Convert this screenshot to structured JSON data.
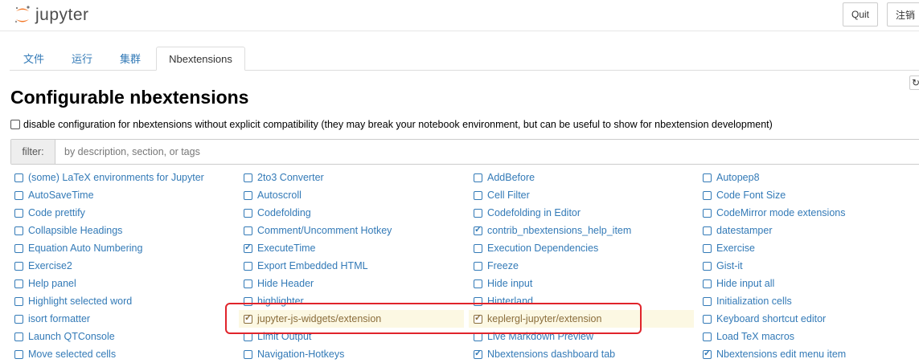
{
  "header": {
    "logo_text": "jupyter",
    "quit_label": "Quit",
    "logout_label": "注销"
  },
  "tabs": [
    {
      "label": "文件",
      "active": false
    },
    {
      "label": "运行",
      "active": false
    },
    {
      "label": "集群",
      "active": false
    },
    {
      "label": "Nbextensions",
      "active": true
    }
  ],
  "refresh_icon": "refresh-icon",
  "page": {
    "title": "Configurable nbextensions",
    "compat_label": "disable configuration for nbextensions without explicit compatibility (they may break your notebook environment, but can be useful to show for nbextension development)",
    "compat_checked": false
  },
  "filter": {
    "label": "filter:",
    "placeholder": "by description, section, or tags",
    "value": ""
  },
  "extensions": [
    [
      {
        "label": "(some) LaTeX environments for Jupyter",
        "checked": false,
        "highlight": false
      },
      {
        "label": "AutoSaveTime",
        "checked": false,
        "highlight": false
      },
      {
        "label": "Code prettify",
        "checked": false,
        "highlight": false
      },
      {
        "label": "Collapsible Headings",
        "checked": false,
        "highlight": false
      },
      {
        "label": "Equation Auto Numbering",
        "checked": false,
        "highlight": false
      },
      {
        "label": "Exercise2",
        "checked": false,
        "highlight": false
      },
      {
        "label": "Help panel",
        "checked": false,
        "highlight": false
      },
      {
        "label": "Highlight selected word",
        "checked": false,
        "highlight": false
      },
      {
        "label": "isort formatter",
        "checked": false,
        "highlight": false
      },
      {
        "label": "Launch QTConsole",
        "checked": false,
        "highlight": false
      },
      {
        "label": "Move selected cells",
        "checked": false,
        "highlight": false
      }
    ],
    [
      {
        "label": "2to3 Converter",
        "checked": false,
        "highlight": false
      },
      {
        "label": "Autoscroll",
        "checked": false,
        "highlight": false
      },
      {
        "label": "Codefolding",
        "checked": false,
        "highlight": false
      },
      {
        "label": "Comment/Uncomment Hotkey",
        "checked": false,
        "highlight": false
      },
      {
        "label": "ExecuteTime",
        "checked": true,
        "highlight": false
      },
      {
        "label": "Export Embedded HTML",
        "checked": false,
        "highlight": false
      },
      {
        "label": "Hide Header",
        "checked": false,
        "highlight": false
      },
      {
        "label": "highlighter",
        "checked": false,
        "highlight": false
      },
      {
        "label": "jupyter-js-widgets/extension",
        "checked": true,
        "highlight": true
      },
      {
        "label": "Limit Output",
        "checked": false,
        "highlight": false
      },
      {
        "label": "Navigation-Hotkeys",
        "checked": false,
        "highlight": false
      }
    ],
    [
      {
        "label": "AddBefore",
        "checked": false,
        "highlight": false
      },
      {
        "label": "Cell Filter",
        "checked": false,
        "highlight": false
      },
      {
        "label": "Codefolding in Editor",
        "checked": false,
        "highlight": false
      },
      {
        "label": "contrib_nbextensions_help_item",
        "checked": true,
        "highlight": false
      },
      {
        "label": "Execution Dependencies",
        "checked": false,
        "highlight": false
      },
      {
        "label": "Freeze",
        "checked": false,
        "highlight": false
      },
      {
        "label": "Hide input",
        "checked": false,
        "highlight": false
      },
      {
        "label": "Hinterland",
        "checked": false,
        "highlight": false
      },
      {
        "label": "keplergl-jupyter/extension",
        "checked": true,
        "highlight": true
      },
      {
        "label": "Live Markdown Preview",
        "checked": false,
        "highlight": false
      },
      {
        "label": "Nbextensions dashboard tab",
        "checked": true,
        "highlight": false
      }
    ],
    [
      {
        "label": "Autopep8",
        "checked": false,
        "highlight": false
      },
      {
        "label": "Code Font Size",
        "checked": false,
        "highlight": false
      },
      {
        "label": "CodeMirror mode extensions",
        "checked": false,
        "highlight": false
      },
      {
        "label": "datestamper",
        "checked": false,
        "highlight": false
      },
      {
        "label": "Exercise",
        "checked": false,
        "highlight": false
      },
      {
        "label": "Gist-it",
        "checked": false,
        "highlight": false
      },
      {
        "label": "Hide input all",
        "checked": false,
        "highlight": false
      },
      {
        "label": "Initialization cells",
        "checked": false,
        "highlight": false
      },
      {
        "label": "Keyboard shortcut editor",
        "checked": false,
        "highlight": false
      },
      {
        "label": "Load TeX macros",
        "checked": false,
        "highlight": false
      },
      {
        "label": "Nbextensions edit menu item",
        "checked": true,
        "highlight": false
      }
    ]
  ],
  "colors": {
    "link": "#337ab7",
    "highlight_bg": "#fcf8e3",
    "annotation": "#e0242b",
    "logo_orange": "#f37726"
  }
}
